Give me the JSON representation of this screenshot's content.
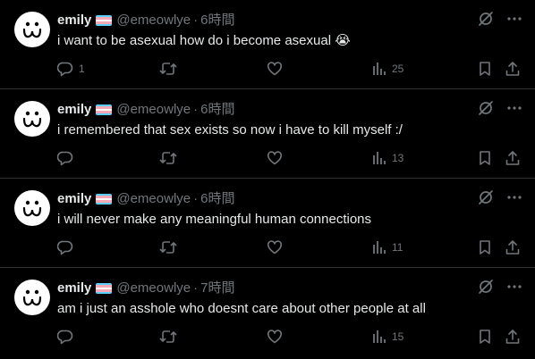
{
  "colors": {
    "background": "#000000",
    "text_primary": "#e7e9ea",
    "text_secondary": "#71767b",
    "divider": "#2f3336",
    "flag_blue": "#5bcefa",
    "flag_pink": "#f5a9b8",
    "flag_white": "#ffffff"
  },
  "icons": {
    "avatar": "doodle-face-icon",
    "flag": "trans-flag-icon",
    "tool1": "grok-slash-circle-icon",
    "tool2": "more-dots-icon",
    "reply": "reply-bubble-icon",
    "retweet": "retweet-icon",
    "like": "heart-icon",
    "views": "bar-chart-icon",
    "bookmark": "bookmark-icon",
    "share": "share-icon"
  },
  "tweets": [
    {
      "name": "emily",
      "handle": "@emeowlye",
      "dot": "·",
      "time": "6時間",
      "text": "i want to be asexual how do i become asexual",
      "emoji": "😭",
      "reply_count": "1",
      "retweet_count": "",
      "like_count": "",
      "views": "25"
    },
    {
      "name": "emily",
      "handle": "@emeowlye",
      "dot": "·",
      "time": "6時間",
      "text": "i remembered that sex exists so now i have to kill myself :/",
      "emoji": "",
      "reply_count": "",
      "retweet_count": "",
      "like_count": "",
      "views": "13"
    },
    {
      "name": "emily",
      "handle": "@emeowlye",
      "dot": "·",
      "time": "6時間",
      "text": "i will never make any meaningful human connections",
      "emoji": "",
      "reply_count": "",
      "retweet_count": "",
      "like_count": "",
      "views": "11"
    },
    {
      "name": "emily",
      "handle": "@emeowlye",
      "dot": "·",
      "time": "7時間",
      "text": "am i just an asshole who doesnt care about other people at all",
      "emoji": "",
      "reply_count": "",
      "retweet_count": "",
      "like_count": "",
      "views": "15"
    }
  ]
}
